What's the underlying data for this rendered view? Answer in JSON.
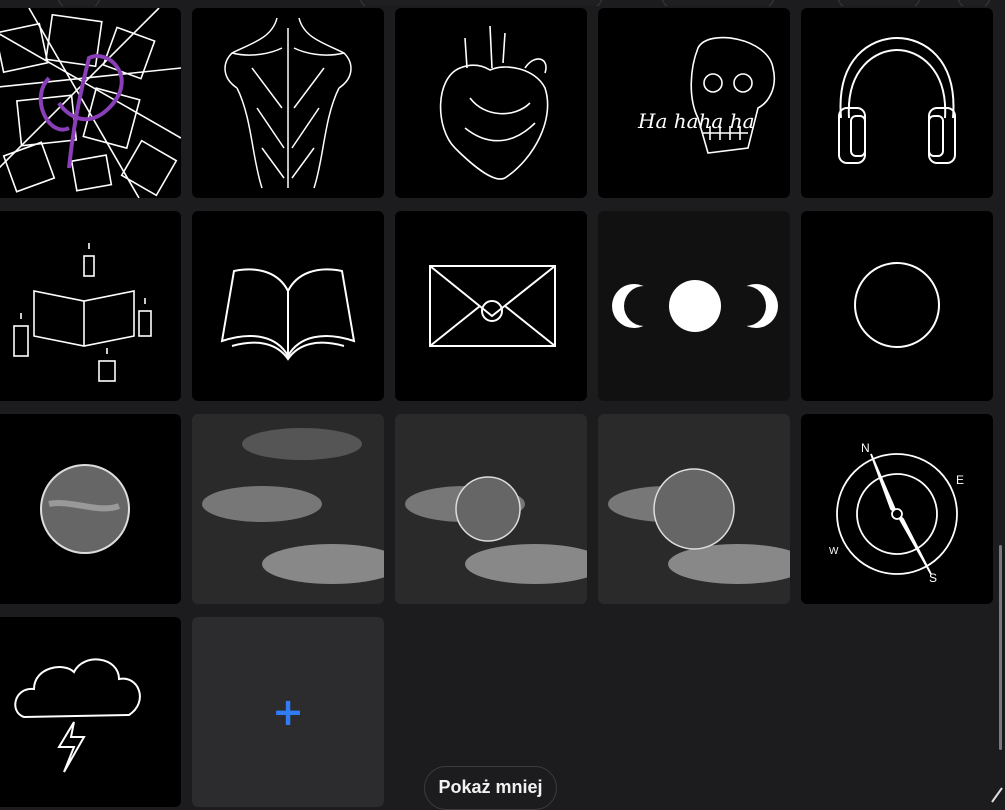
{
  "gallery": {
    "tiles": [
      {
        "name": "tile-abstract-p"
      },
      {
        "name": "tile-back-muscles"
      },
      {
        "name": "tile-heart"
      },
      {
        "name": "tile-laughing-skull"
      },
      {
        "name": "tile-headphones"
      },
      {
        "name": "tile-book-candles"
      },
      {
        "name": "tile-open-book"
      },
      {
        "name": "tile-envelope"
      },
      {
        "name": "tile-triple-moon"
      },
      {
        "name": "tile-circle"
      },
      {
        "name": "tile-full-moon"
      },
      {
        "name": "tile-clouds"
      },
      {
        "name": "tile-moon-clouds-1"
      },
      {
        "name": "tile-moon-clouds-2"
      },
      {
        "name": "tile-compass"
      },
      {
        "name": "tile-storm-cloud"
      }
    ],
    "skull_text": "Ha haha ha",
    "compass_letters": {
      "n": "N",
      "e": "E",
      "s": "S",
      "w": "W"
    },
    "add_icon": "+",
    "accent_color": "#2f7cf6"
  },
  "footer": {
    "show_less_label": "Pokaż mniej"
  }
}
